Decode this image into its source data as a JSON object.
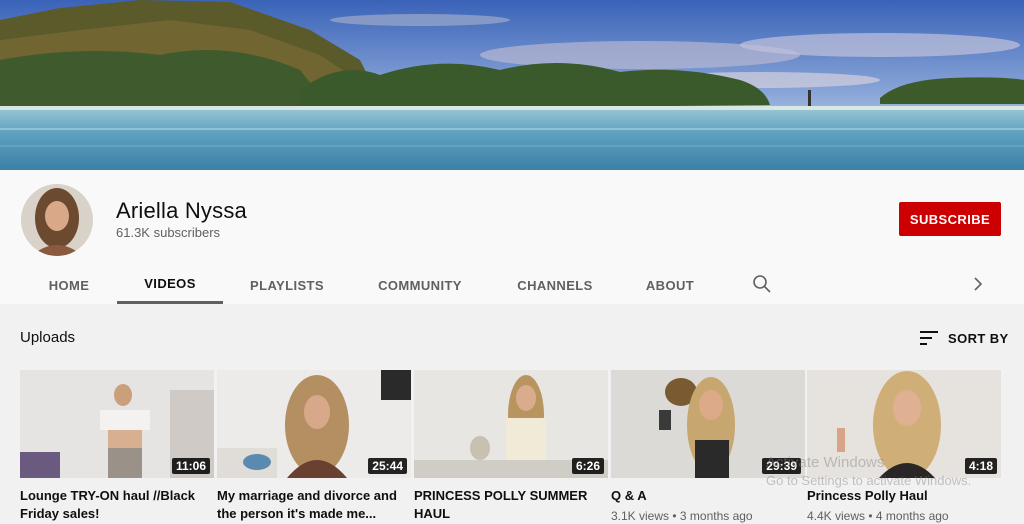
{
  "channel": {
    "name": "Ariella Nyssa",
    "subscribers": "61.3K subscribers",
    "subscribe_label": "SUBSCRIBE"
  },
  "tabs": [
    {
      "label": "HOME",
      "active": false
    },
    {
      "label": "VIDEOS",
      "active": true
    },
    {
      "label": "PLAYLISTS",
      "active": false
    },
    {
      "label": "COMMUNITY",
      "active": false
    },
    {
      "label": "CHANNELS",
      "active": false
    },
    {
      "label": "ABOUT",
      "active": false
    }
  ],
  "icons": {
    "search": "search-icon",
    "next": "chevron-right-icon",
    "sort": "sort-icon"
  },
  "section": {
    "title": "Uploads",
    "sort_label": "SORT BY"
  },
  "videos": [
    {
      "title": "Lounge TRY-ON haul //Black Friday sales!",
      "duration": "11:06",
      "meta": ""
    },
    {
      "title": "My marriage and divorce and the person it's made me...",
      "duration": "25:44",
      "meta": ""
    },
    {
      "title": "PRINCESS POLLY SUMMER HAUL",
      "duration": "6:26",
      "meta": ""
    },
    {
      "title": "Q & A",
      "duration": "29:39",
      "meta": "3.1K views • 3 months ago"
    },
    {
      "title": "Princess Polly Haul",
      "duration": "4:18",
      "meta": "4.4K views • 4 months ago"
    }
  ],
  "watermark": {
    "line1": "Activate Windows",
    "line2": "Go to Settings to activate Windows."
  },
  "colors": {
    "subscribe": "#cc0000",
    "background": "#f1f1f1",
    "header": "#f9f9f9"
  }
}
